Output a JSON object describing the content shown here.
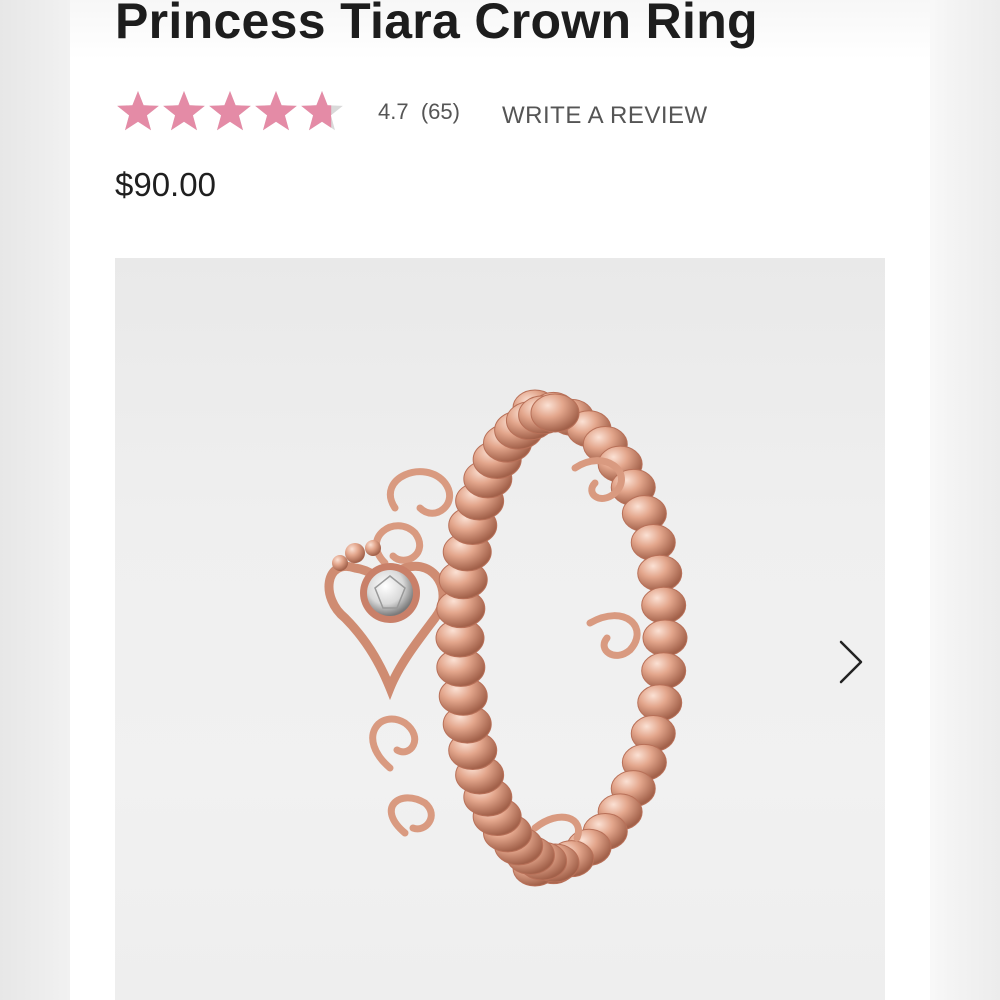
{
  "product": {
    "title": "Princess Tiara Crown Ring",
    "rating": {
      "stars": 4.7,
      "max_stars": 5,
      "value_text": "4.7",
      "count_text": "(65)",
      "star_color": "#e48ba6",
      "star_empty_color": "#d9d9d9"
    },
    "write_review_label": "WRITE A REVIEW",
    "price": "$90.00"
  },
  "gallery": {
    "image_subject": "rose gold tiara crown ring",
    "next_icon": "chevron-right-icon",
    "metal_color": "#e2a58c"
  }
}
